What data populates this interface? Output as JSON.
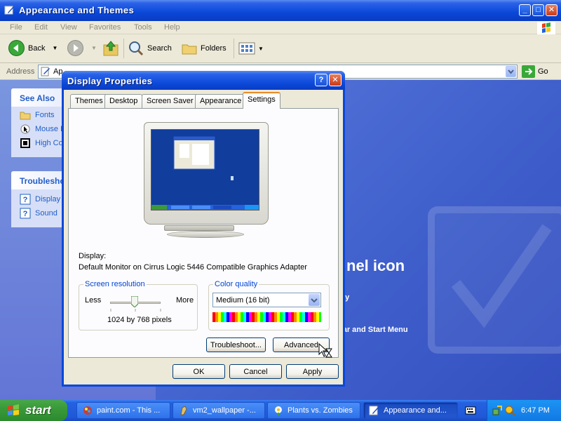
{
  "explorer": {
    "title": "Appearance and Themes",
    "menu": [
      "File",
      "Edit",
      "View",
      "Favorites",
      "Tools",
      "Help"
    ],
    "toolbar": {
      "back": "Back",
      "search": "Search",
      "folders": "Folders"
    },
    "address": {
      "label": "Address",
      "value": "Ap",
      "go": "Go"
    },
    "see_also": {
      "title": "See Also",
      "items": [
        "Fonts",
        "Mouse P",
        "High Co"
      ]
    },
    "troubleshooters": {
      "title": "Troublesho",
      "items": [
        "Display",
        "Sound"
      ]
    },
    "main_text": {
      "heading_fragment": "nel icon",
      "line1_fragment": "ay",
      "line2_fragment": "bar and Start Menu"
    }
  },
  "dialog": {
    "title": "Display Properties",
    "tabs": [
      "Themes",
      "Desktop",
      "Screen Saver",
      "Appearance",
      "Settings"
    ],
    "active_tab": "Settings",
    "display_label": "Display:",
    "display_value": "Default Monitor on Cirrus Logic 5446 Compatible Graphics Adapter",
    "resolution": {
      "label": "Screen resolution",
      "less": "Less",
      "more": "More",
      "value": "1024 by 768 pixels",
      "slider_position_fraction": 0.4
    },
    "color_quality": {
      "label": "Color quality",
      "value": "Medium (16 bit)"
    },
    "buttons": {
      "troubleshoot": "Troubleshoot...",
      "advanced": "Advanced",
      "ok": "OK",
      "cancel": "Cancel",
      "apply": "Apply"
    }
  },
  "taskbar": {
    "start": "start",
    "tasks": [
      "paint.com - This ...",
      "vm2_wallpaper -...",
      "Plants vs. Zombies",
      "Appearance and..."
    ],
    "active_task": 3,
    "clock": "6:47 PM"
  },
  "colors": {
    "xp_blue": "#0a48d8",
    "dialog_face": "#ece9d8",
    "link_blue": "#215dc6",
    "group_label": "#0046d5",
    "start_green": "#3a9a3a"
  }
}
